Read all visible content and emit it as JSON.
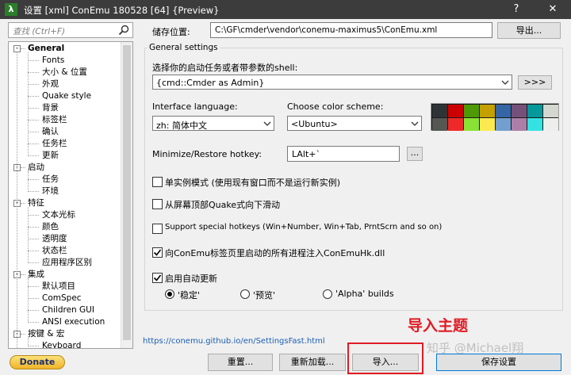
{
  "window": {
    "app_icon": "λ",
    "title": "设置 [xml] ConEmu 180528 [64] {Preview}",
    "help_label": "?",
    "close_label": "✕"
  },
  "search": {
    "placeholder": "查找 (Ctrl+F)"
  },
  "tree": {
    "items": [
      {
        "label": "General",
        "level": 0,
        "bold": true,
        "expander": "-"
      },
      {
        "label": "Fonts",
        "level": 1
      },
      {
        "label": "大小 & 位置",
        "level": 1
      },
      {
        "label": "外观",
        "level": 1
      },
      {
        "label": "Quake style",
        "level": 1
      },
      {
        "label": "背景",
        "level": 1
      },
      {
        "label": "标签栏",
        "level": 1
      },
      {
        "label": "确认",
        "level": 1
      },
      {
        "label": "任务栏",
        "level": 1
      },
      {
        "label": "更新",
        "level": 1
      },
      {
        "label": "启动",
        "level": 0,
        "expander": "-"
      },
      {
        "label": "任务",
        "level": 1
      },
      {
        "label": "环境",
        "level": 1
      },
      {
        "label": "特征",
        "level": 0,
        "expander": "-"
      },
      {
        "label": "文本光标",
        "level": 1
      },
      {
        "label": "颜色",
        "level": 1
      },
      {
        "label": "透明度",
        "level": 1
      },
      {
        "label": "状态栏",
        "level": 1
      },
      {
        "label": "应用程序区别",
        "level": 1
      },
      {
        "label": "集成",
        "level": 0,
        "expander": "-"
      },
      {
        "label": "默认项目",
        "level": 1
      },
      {
        "label": "ComSpec",
        "level": 1
      },
      {
        "label": "Children GUI",
        "level": 1
      },
      {
        "label": "ANSI execution",
        "level": 1
      },
      {
        "label": "按键 & 宏",
        "level": 0,
        "expander": "-"
      },
      {
        "label": "Keyboard",
        "level": 1
      }
    ]
  },
  "storage": {
    "label": "储存位置:",
    "path": "C:\\GF\\cmder\\vendor\\conemu-maximus5\\ConEmu.xml",
    "export_label": "导出..."
  },
  "general": {
    "group_title": "General settings",
    "startup_label": "选择你的启动任务或者带参数的shell:",
    "startup_value": "{cmd::Cmder as Admin}",
    "startup_more": ">>>",
    "language_label": "Interface language:",
    "language_value": "zh: 简体中文",
    "scheme_label": "Choose color scheme:",
    "scheme_value": "<Ubuntu>",
    "palette": [
      "#2e3436",
      "#cc0000",
      "#4e9a06",
      "#c4a000",
      "#3465a4",
      "#75507b",
      "#06989a",
      "#d3d7cf",
      "#555753",
      "#ef2929",
      "#8ae234",
      "#fce94f",
      "#729fcf",
      "#ad7fa8",
      "#34e2e2",
      "#eeeeec"
    ],
    "hotkey_label": "Minimize/Restore hotkey:",
    "hotkey_value": "LAlt+`",
    "hotkey_more": "...",
    "options": [
      {
        "label": "单实例模式 (使用现有窗口而不是运行新实例)",
        "checked": false
      },
      {
        "label": "从屏幕顶部Quake式向下滑动",
        "checked": false
      },
      {
        "label": "Support special hotkeys (Win+Number, Win+Tab, PrntScrn and so on)",
        "checked": false
      },
      {
        "label": "向ConEmu标签页里启动的所有进程注入ConEmuHk.dll",
        "checked": true
      },
      {
        "label": "启用自动更新",
        "checked": true
      }
    ],
    "update_channels": [
      {
        "label": "'稳定'",
        "selected": true
      },
      {
        "label": "'预览'",
        "selected": false
      },
      {
        "label": "'Alpha' builds",
        "selected": false
      }
    ]
  },
  "footer": {
    "link": "https://conemu.github.io/en/SettingsFast.html",
    "donate_label": "Donate",
    "reset_label": "重置...",
    "reload_label": "重新加载...",
    "import_label": "导入...",
    "save_label": "保存设置",
    "annotation": "导入主题",
    "watermark": "知乎 @Michael翔"
  }
}
